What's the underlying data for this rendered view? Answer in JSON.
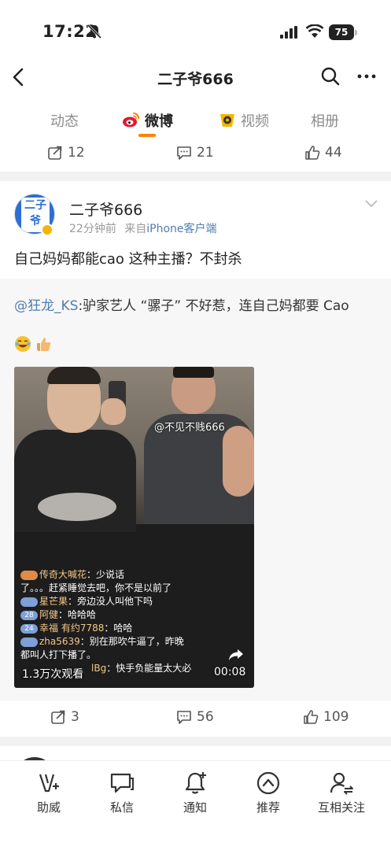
{
  "status_bar": {
    "time": "17:22",
    "battery": "75"
  },
  "nav": {
    "title": "二子爷666"
  },
  "tabs": [
    {
      "label": "动态"
    },
    {
      "label": "微博"
    },
    {
      "label": "视频"
    },
    {
      "label": "相册"
    }
  ],
  "prev_post_actions": {
    "reposts": "12",
    "comments": "21",
    "likes": "44"
  },
  "post": {
    "author": "二子爷666",
    "time": "22分钟前",
    "source_prefix": "来自",
    "source": "iPhone客户端",
    "text": "自己妈妈都能cao 这种主播？不封杀",
    "avatar_text": "二子爷",
    "repost": {
      "mention": "@狂龙_KS",
      "text": ":驴家艺人 “骡子” 不好惹，连自己妈都要 Cao",
      "video": {
        "watermark": "@不见不贱666",
        "view_count": "1.3万次观看",
        "duration": "00:08",
        "chat": [
          {
            "level": "",
            "name": "传奇大喊花",
            "text": "：少说话"
          },
          {
            "level": "",
            "name": "",
            "text": "了。。。赶紧睡觉去吧，你不是以前了"
          },
          {
            "level": "",
            "name": "星芒果",
            "text": "：旁边没人叫他下吗"
          },
          {
            "level": "28",
            "name": "阿健",
            "text": "：哈哈哈"
          },
          {
            "level": "24",
            "name": "幸福 有约7788",
            "text": "：哈哈"
          },
          {
            "level": "",
            "name": "zha5639",
            "text": "：别在那吹牛逼了，昨晚"
          },
          {
            "level": "",
            "name": "",
            "text": "都叫人打下播了。"
          },
          {
            "level": "",
            "name": "lBg",
            "text": "：快手负能量太大必"
          }
        ]
      }
    },
    "actions": {
      "reposts": "3",
      "comments": "56",
      "likes": "109"
    }
  },
  "bottom_bar": [
    {
      "label": "助威",
      "icon": "cheer-icon"
    },
    {
      "label": "私信",
      "icon": "message-icon"
    },
    {
      "label": "通知",
      "icon": "bell-icon"
    },
    {
      "label": "推荐",
      "icon": "recommend-icon"
    },
    {
      "label": "互相关注",
      "icon": "mutual-follow-icon"
    }
  ],
  "colors": {
    "accent": "#ff8200",
    "link": "#507daf"
  }
}
